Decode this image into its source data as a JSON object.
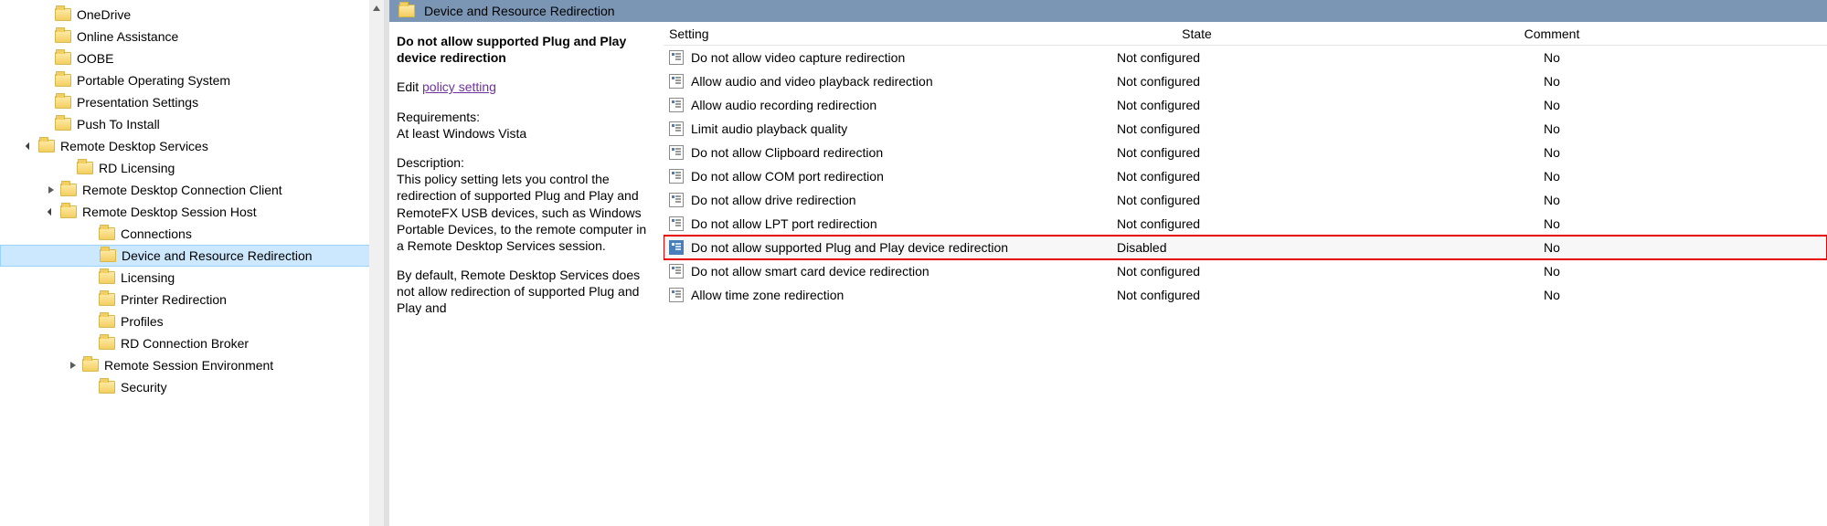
{
  "tree": [
    {
      "label": "OneDrive",
      "indent": 42,
      "expander": "",
      "selected": false
    },
    {
      "label": "Online Assistance",
      "indent": 42,
      "expander": "",
      "selected": false
    },
    {
      "label": "OOBE",
      "indent": 42,
      "expander": "",
      "selected": false
    },
    {
      "label": "Portable Operating System",
      "indent": 42,
      "expander": "",
      "selected": false
    },
    {
      "label": "Presentation Settings",
      "indent": 42,
      "expander": "",
      "selected": false
    },
    {
      "label": "Push To Install",
      "indent": 42,
      "expander": "",
      "selected": false
    },
    {
      "label": "Remote Desktop Services",
      "indent": 24,
      "expander": "open",
      "selected": false
    },
    {
      "label": "RD Licensing",
      "indent": 66,
      "expander": "",
      "selected": false
    },
    {
      "label": "Remote Desktop Connection Client",
      "indent": 48,
      "expander": "closed",
      "selected": false
    },
    {
      "label": "Remote Desktop Session Host",
      "indent": 48,
      "expander": "open",
      "selected": false
    },
    {
      "label": "Connections",
      "indent": 90,
      "expander": "",
      "selected": false
    },
    {
      "label": "Device and Resource Redirection",
      "indent": 90,
      "expander": "",
      "selected": true
    },
    {
      "label": "Licensing",
      "indent": 90,
      "expander": "",
      "selected": false
    },
    {
      "label": "Printer Redirection",
      "indent": 90,
      "expander": "",
      "selected": false
    },
    {
      "label": "Profiles",
      "indent": 90,
      "expander": "",
      "selected": false
    },
    {
      "label": "RD Connection Broker",
      "indent": 90,
      "expander": "",
      "selected": false
    },
    {
      "label": "Remote Session Environment",
      "indent": 72,
      "expander": "closed",
      "selected": false
    },
    {
      "label": "Security",
      "indent": 90,
      "expander": "",
      "selected": false
    }
  ],
  "pathHeader": "Device and Resource Redirection",
  "description": {
    "title": "Do not allow supported Plug and Play device redirection",
    "editPrefix": "Edit ",
    "editLink": "policy setting",
    "reqLabel": "Requirements:",
    "reqText": "At least Windows Vista",
    "descLabel": "Description:",
    "descText1": "This policy setting lets you control the redirection of supported Plug and Play and RemoteFX USB devices, such as Windows Portable Devices, to the remote computer in a Remote Desktop Services session.",
    "descText2": "By default, Remote Desktop Services does not allow redirection of supported Plug and Play and"
  },
  "columns": {
    "setting": "Setting",
    "state": "State",
    "comment": "Comment"
  },
  "policies": [
    {
      "name": "Do not allow video capture redirection",
      "state": "Not configured",
      "comment": "No",
      "selected": false,
      "highlight": false
    },
    {
      "name": "Allow audio and video playback redirection",
      "state": "Not configured",
      "comment": "No",
      "selected": false,
      "highlight": false
    },
    {
      "name": "Allow audio recording redirection",
      "state": "Not configured",
      "comment": "No",
      "selected": false,
      "highlight": false
    },
    {
      "name": "Limit audio playback quality",
      "state": "Not configured",
      "comment": "No",
      "selected": false,
      "highlight": false
    },
    {
      "name": "Do not allow Clipboard redirection",
      "state": "Not configured",
      "comment": "No",
      "selected": false,
      "highlight": false
    },
    {
      "name": "Do not allow COM port redirection",
      "state": "Not configured",
      "comment": "No",
      "selected": false,
      "highlight": false
    },
    {
      "name": "Do not allow drive redirection",
      "state": "Not configured",
      "comment": "No",
      "selected": false,
      "highlight": false
    },
    {
      "name": "Do not allow LPT port redirection",
      "state": "Not configured",
      "comment": "No",
      "selected": false,
      "highlight": false
    },
    {
      "name": "Do not allow supported Plug and Play device redirection",
      "state": "Disabled",
      "comment": "No",
      "selected": true,
      "highlight": true
    },
    {
      "name": "Do not allow smart card device redirection",
      "state": "Not configured",
      "comment": "No",
      "selected": false,
      "highlight": false
    },
    {
      "name": "Allow time zone redirection",
      "state": "Not configured",
      "comment": "No",
      "selected": false,
      "highlight": false
    }
  ]
}
